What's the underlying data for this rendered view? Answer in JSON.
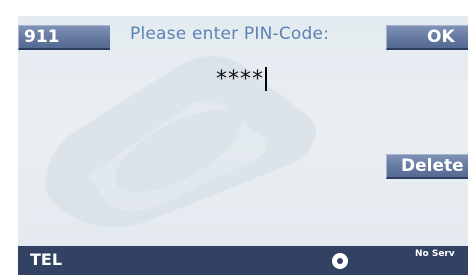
{
  "header": {
    "left_button_label": "911",
    "title": "Please enter PIN-Code:",
    "ok_button_label": "OK"
  },
  "pin_entry": {
    "masked_value": "****"
  },
  "side_actions": {
    "delete_button_label": "Delete"
  },
  "status_bar": {
    "mode_label": "TEL",
    "center_icon": "disc-icon",
    "network_status": "No Serv"
  },
  "colors": {
    "button_fill": "#6478a0",
    "title_text": "#5c82b4",
    "status_bar": "#334163",
    "screen_bg": "#e6ecf0"
  }
}
